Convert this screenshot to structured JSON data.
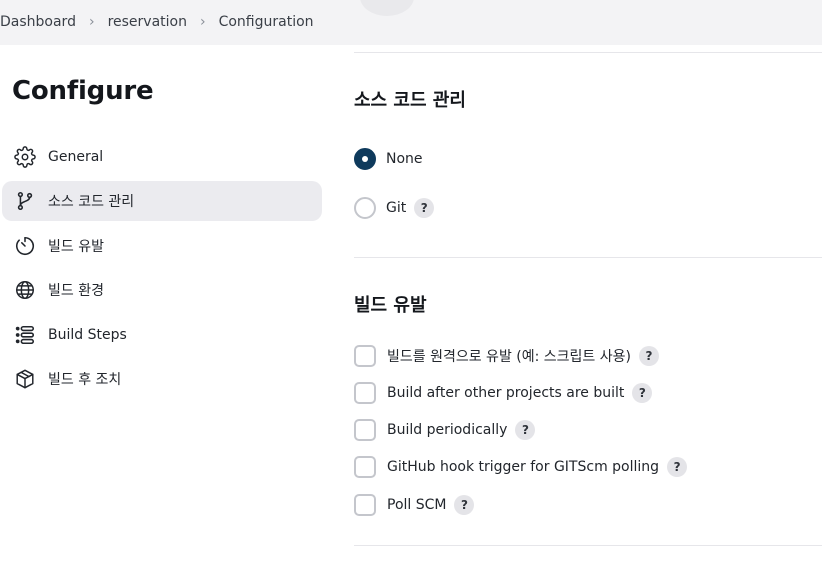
{
  "breadcrumb": {
    "items": [
      "Dashboard",
      "reservation",
      "Configuration"
    ]
  },
  "page": {
    "title": "Configure"
  },
  "sidebar": {
    "items": [
      {
        "label": "General",
        "icon": "gear-icon"
      },
      {
        "label": "소스 코드 관리",
        "icon": "branch-icon",
        "active": true
      },
      {
        "label": "빌드 유발",
        "icon": "timer-icon"
      },
      {
        "label": "빌드 환경",
        "icon": "globe-icon"
      },
      {
        "label": "Build Steps",
        "icon": "list-icon"
      },
      {
        "label": "빌드 후 조치",
        "icon": "package-icon"
      }
    ]
  },
  "scm": {
    "title": "소스 코드 관리",
    "options": [
      {
        "label": "None",
        "checked": true
      },
      {
        "label": "Git",
        "checked": false,
        "help": "?"
      }
    ]
  },
  "triggers": {
    "title": "빌드 유발",
    "options": [
      {
        "label": "빌드를 원격으로 유발 (예: 스크립트 사용)",
        "checked": false,
        "help": "?"
      },
      {
        "label": "Build after other projects are built",
        "checked": false,
        "help": "?"
      },
      {
        "label": "Build periodically",
        "checked": false,
        "help": "?"
      },
      {
        "label": "GitHub hook trigger for GITScm polling",
        "checked": false,
        "help": "?"
      },
      {
        "label": "Poll SCM",
        "checked": false,
        "help": "?"
      }
    ]
  },
  "colors": {
    "accent": "#0e3a5c",
    "active_bg": "#ebebef",
    "topbar_bg": "#f3f3f5"
  }
}
